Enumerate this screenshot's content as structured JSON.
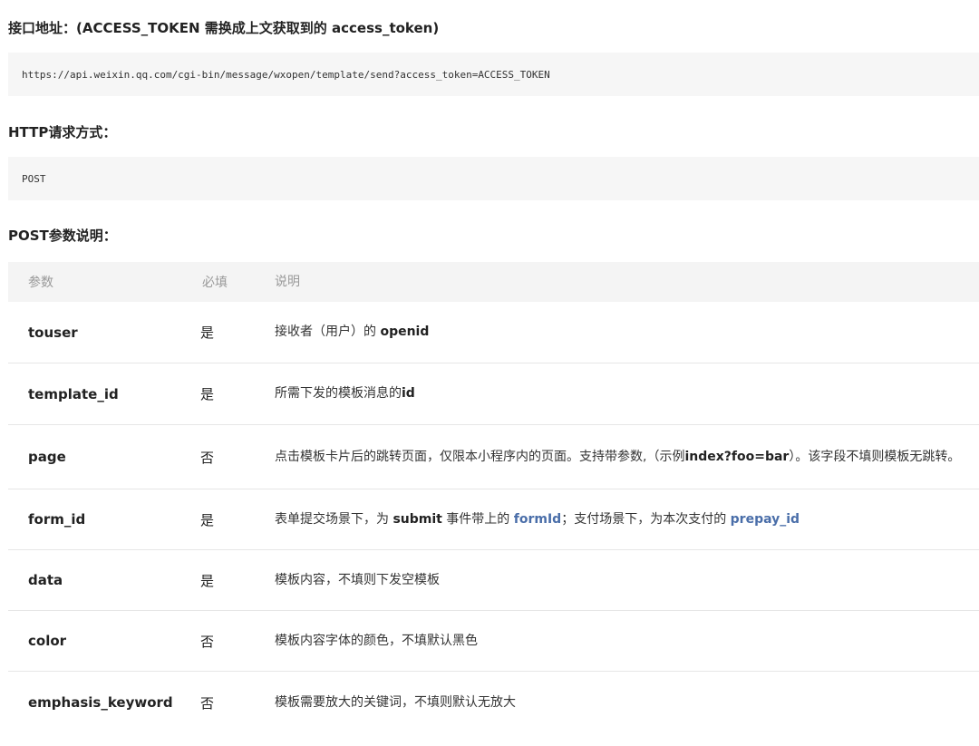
{
  "sections": {
    "endpoint_heading": "接口地址：(ACCESS_TOKEN 需换成上文获取到的 access_token)",
    "endpoint_url": "https://api.weixin.qq.com/cgi-bin/message/wxopen/template/send?access_token=ACCESS_TOKEN",
    "method_heading": "HTTP请求方式：",
    "method_value": "POST",
    "params_heading": "POST参数说明："
  },
  "table": {
    "headers": [
      "参数",
      "必填",
      "说明"
    ],
    "rows": [
      {
        "param": "touser",
        "required": "是",
        "desc": [
          {
            "text": "接收者（用户）的 "
          },
          {
            "text": "openid",
            "style": "bold"
          }
        ]
      },
      {
        "param": "template_id",
        "required": "是",
        "desc": [
          {
            "text": "所需下发的模板消息的"
          },
          {
            "text": "id",
            "style": "bold"
          }
        ]
      },
      {
        "param": "page",
        "required": "否",
        "desc": [
          {
            "text": "点击模板卡片后的跳转页面，仅限本小程序内的页面。支持带参数,（示例"
          },
          {
            "text": "index?foo=bar",
            "style": "bold"
          },
          {
            "text": "）。该字段不填则模板无跳转。"
          }
        ]
      },
      {
        "param": "form_id",
        "required": "是",
        "desc": [
          {
            "text": "表单提交场景下，为 "
          },
          {
            "text": "submit",
            "style": "bold"
          },
          {
            "text": " 事件带上的 "
          },
          {
            "text": "formId",
            "style": "link"
          },
          {
            "text": "；支付场景下，为本次支付的 "
          },
          {
            "text": "prepay_id",
            "style": "link"
          }
        ]
      },
      {
        "param": "data",
        "required": "是",
        "desc": [
          {
            "text": "模板内容，不填则下发空模板"
          }
        ]
      },
      {
        "param": "color",
        "required": "否",
        "desc": [
          {
            "text": "模板内容字体的颜色，不填默认黑色"
          }
        ]
      },
      {
        "param": "emphasis_keyword",
        "required": "否",
        "desc": [
          {
            "text": "模板需要放大的关键词，不填则默认无放大"
          }
        ]
      }
    ]
  },
  "colors": {
    "link": "#4a6ea9",
    "code_bg": "#f6f6f6",
    "header_bg": "#f4f4f4",
    "header_text": "#999999"
  }
}
